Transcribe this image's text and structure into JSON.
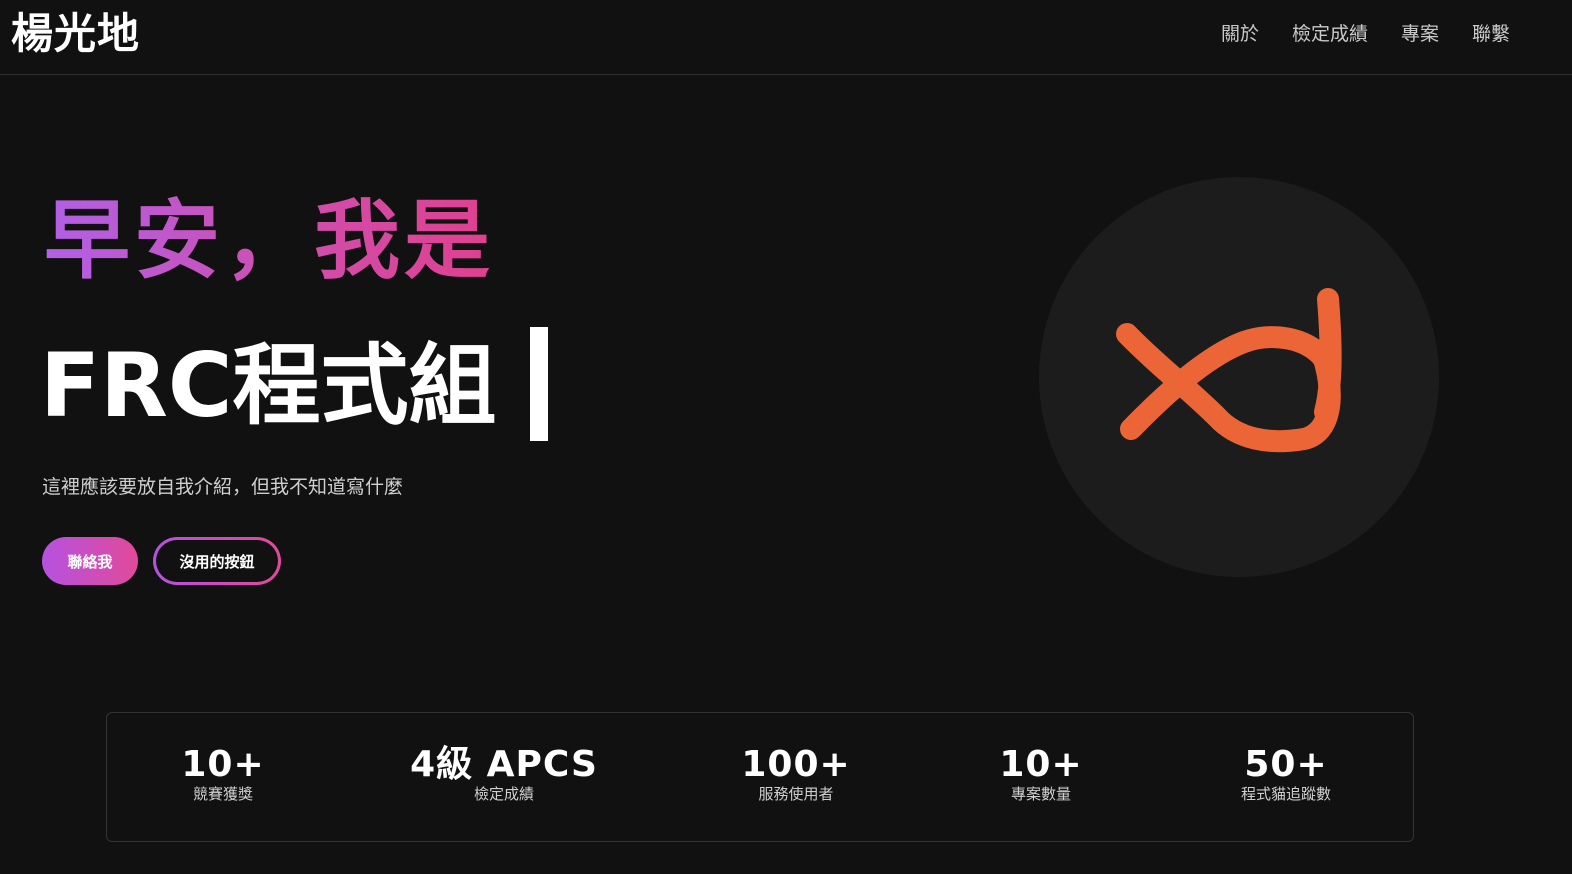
{
  "header": {
    "logo": "楊光地",
    "nav": [
      "關於",
      "檢定成績",
      "專案",
      "聯繫"
    ]
  },
  "hero": {
    "greeting": "早安，我是",
    "role": "FRC程式組",
    "intro": "這裡應該要放自我介紹，但我不知道寫什麼",
    "primary_button": "聯絡我",
    "secondary_button": "沒用的按鈕",
    "avatar_icon": "xd-logo-icon",
    "colors": {
      "gradient_start": "#b260e6",
      "gradient_end": "#e0408e",
      "avatar_stroke": "#ec6536"
    }
  },
  "stats": [
    {
      "value": "10+",
      "label": "競賽獲獎"
    },
    {
      "value": "4級 APCS",
      "label": "檢定成績"
    },
    {
      "value": "100+",
      "label": "服務使用者"
    },
    {
      "value": "10+",
      "label": "專案數量"
    },
    {
      "value": "50+",
      "label": "程式貓追蹤數"
    }
  ]
}
